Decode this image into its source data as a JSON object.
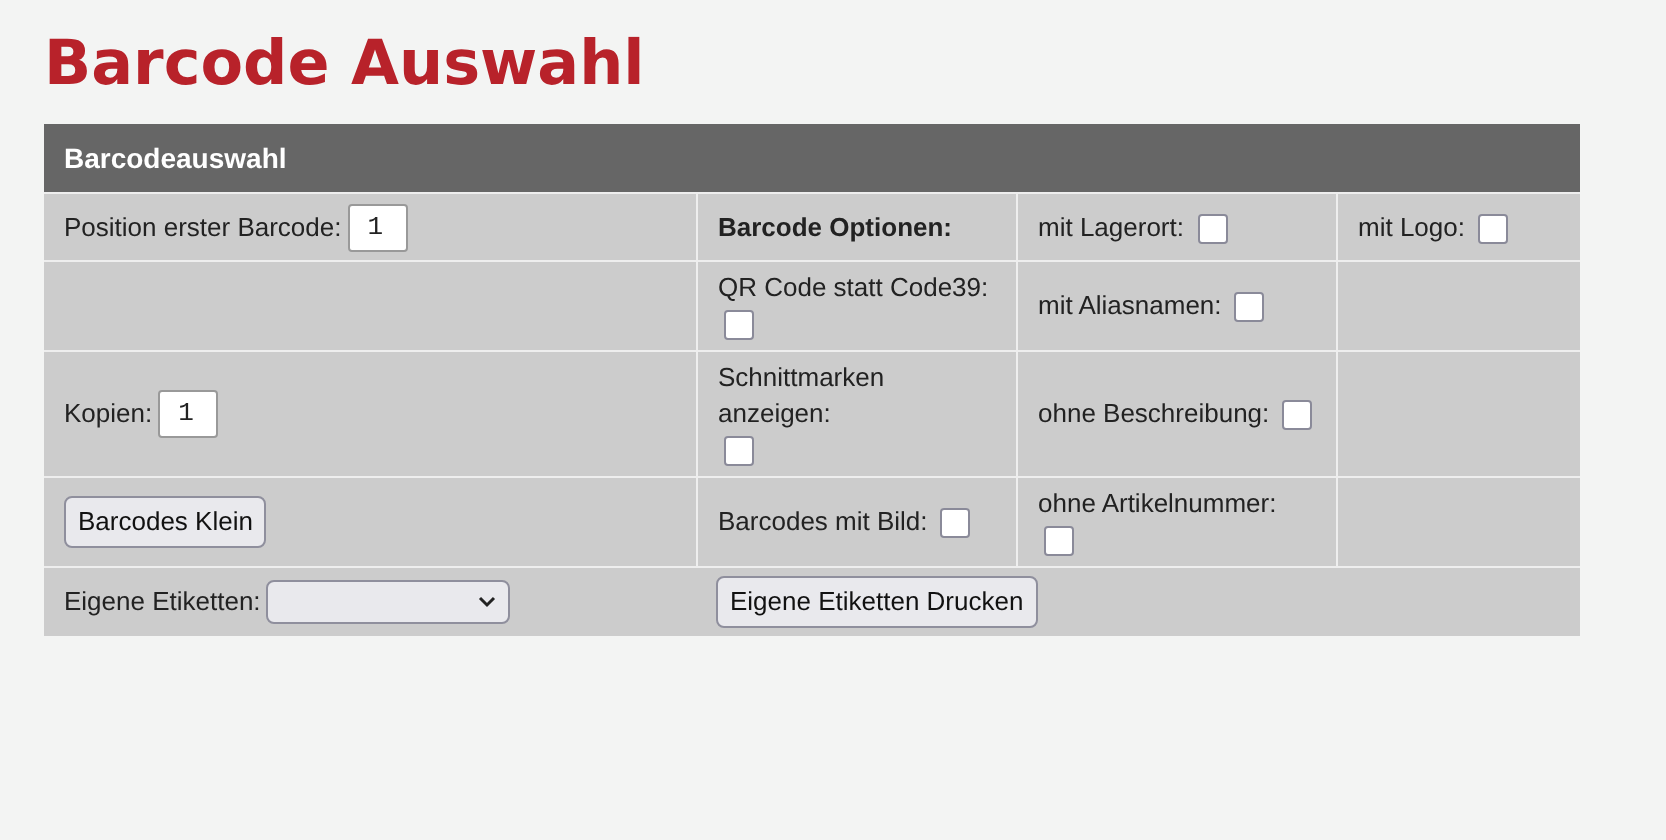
{
  "title": "Barcode Auswahl",
  "panel": {
    "title": "Barcodeauswahl",
    "rows": [
      [
        {
          "kind": "number",
          "label": "Position erster Barcode:",
          "value": "1"
        },
        {
          "kind": "heading",
          "label": "Barcode Optionen:"
        },
        {
          "kind": "checkbox",
          "label": "mit Lagerort:",
          "checked": false
        },
        {
          "kind": "checkbox",
          "label": "mit Logo:",
          "checked": false
        }
      ],
      [
        {
          "kind": "empty"
        },
        {
          "kind": "checkbox",
          "label": "QR Code statt Code39:",
          "checked": false
        },
        {
          "kind": "checkbox",
          "label": "mit Aliasnamen:",
          "checked": false
        },
        {
          "kind": "empty"
        }
      ],
      [
        {
          "kind": "number",
          "label": "Kopien:",
          "value": "1"
        },
        {
          "kind": "checkbox",
          "label": "Schnittmarken anzeigen:",
          "checked": false
        },
        {
          "kind": "checkbox",
          "label": "ohne Beschreibung:",
          "checked": false
        },
        {
          "kind": "empty"
        }
      ],
      [
        {
          "kind": "button",
          "label": "Barcodes Klein"
        },
        {
          "kind": "checkbox",
          "label": "Barcodes mit Bild:",
          "checked": false
        },
        {
          "kind": "checkbox",
          "label": "ohne Artikelnummer:",
          "checked": false
        },
        {
          "kind": "empty"
        }
      ],
      [
        {
          "kind": "select",
          "label": "Eigene Etiketten:"
        },
        {
          "kind": "button",
          "label": "Eigene Etiketten Drucken"
        }
      ]
    ]
  }
}
